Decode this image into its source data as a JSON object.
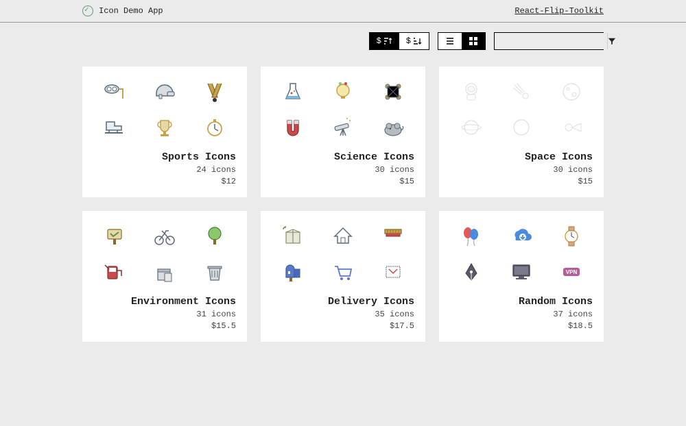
{
  "header": {
    "title": "Icon Demo App",
    "link_label": "React-Flip-Toolkit"
  },
  "toolbar": {
    "sort_asc_active": true,
    "view_grid_active": true
  },
  "cards": [
    {
      "title": "Sports Icons",
      "count": "24 icons",
      "price": "$12",
      "icons": [
        "snorkel-icon",
        "helmet-icon",
        "hockey-icon",
        "skate-icon",
        "trophy-icon",
        "stopwatch-icon"
      ],
      "faded": false
    },
    {
      "title": "Science Icons",
      "count": "30 icons",
      "price": "$15",
      "icons": [
        "flask-icon",
        "idea-icon",
        "molecule-icon",
        "magnet-icon",
        "telescope-icon",
        "mouse-icon"
      ],
      "faded": false
    },
    {
      "title": "Space Icons",
      "count": "30 icons",
      "price": "$15",
      "icons": [
        "astronaut-icon",
        "comet-icon",
        "moon-icon",
        "planet-icon",
        "planet2-icon",
        "satellite-icon"
      ],
      "faded": true
    },
    {
      "title": "Environment Icons",
      "count": "31 icons",
      "price": "$15.5",
      "icons": [
        "sign-icon",
        "bicycle-icon",
        "tree-icon",
        "fuel-icon",
        "recycle-bin-icon",
        "trash-icon"
      ],
      "faded": false
    },
    {
      "title": "Delivery Icons",
      "count": "35 icons",
      "price": "$17.5",
      "icons": [
        "box-icon",
        "house-icon",
        "scale-icon",
        "mailbox-icon",
        "cart-icon",
        "stamp-icon"
      ],
      "faded": false
    },
    {
      "title": "Random Icons",
      "count": "37 icons",
      "price": "$18.5",
      "icons": [
        "balloons-icon",
        "cloud-download-icon",
        "watch-icon",
        "pen-nib-icon",
        "monitor-icon",
        "vpn-icon"
      ],
      "faded": false
    }
  ]
}
